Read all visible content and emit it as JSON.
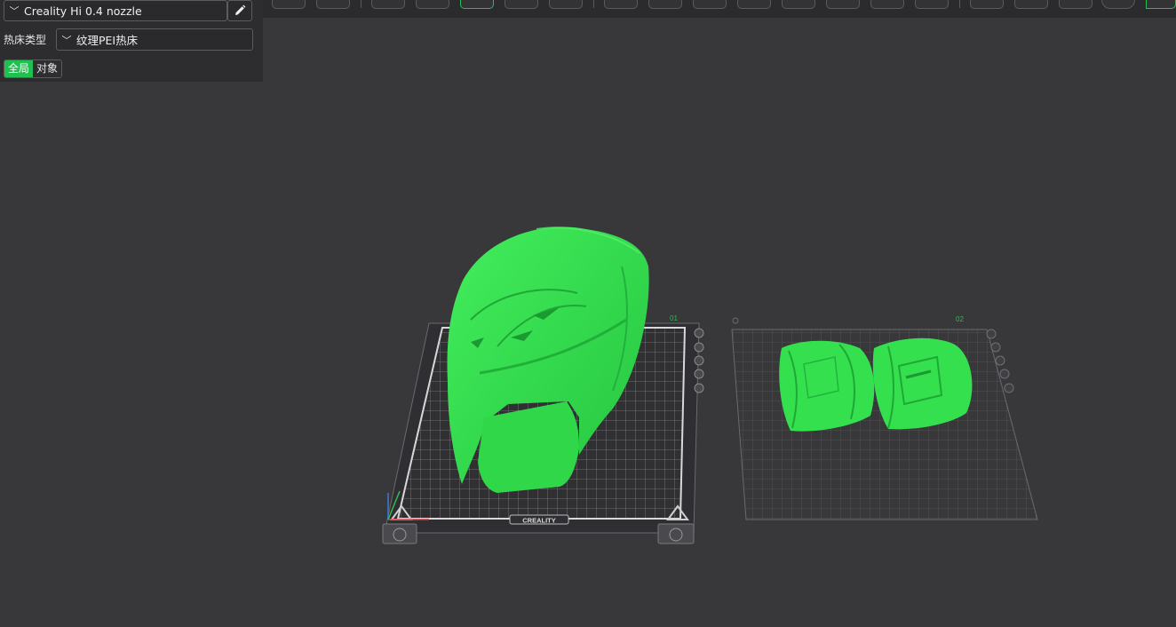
{
  "printer": {
    "name": "Creality Hi 0.4 nozzle",
    "chevron_icon": "chevron-down-icon",
    "edit_icon": "pencil-icon"
  },
  "bed": {
    "label": "热床类型",
    "value": "纹理PEI热床"
  },
  "scope": {
    "global_label": "全局",
    "object_label": "对象"
  },
  "plates": {
    "plate1_number": "01",
    "plate2_number": "02",
    "bed_logo": "CREALITY"
  },
  "colors": {
    "accent": "#1fbf50",
    "model": "#35e04f",
    "background": "#38383b"
  }
}
